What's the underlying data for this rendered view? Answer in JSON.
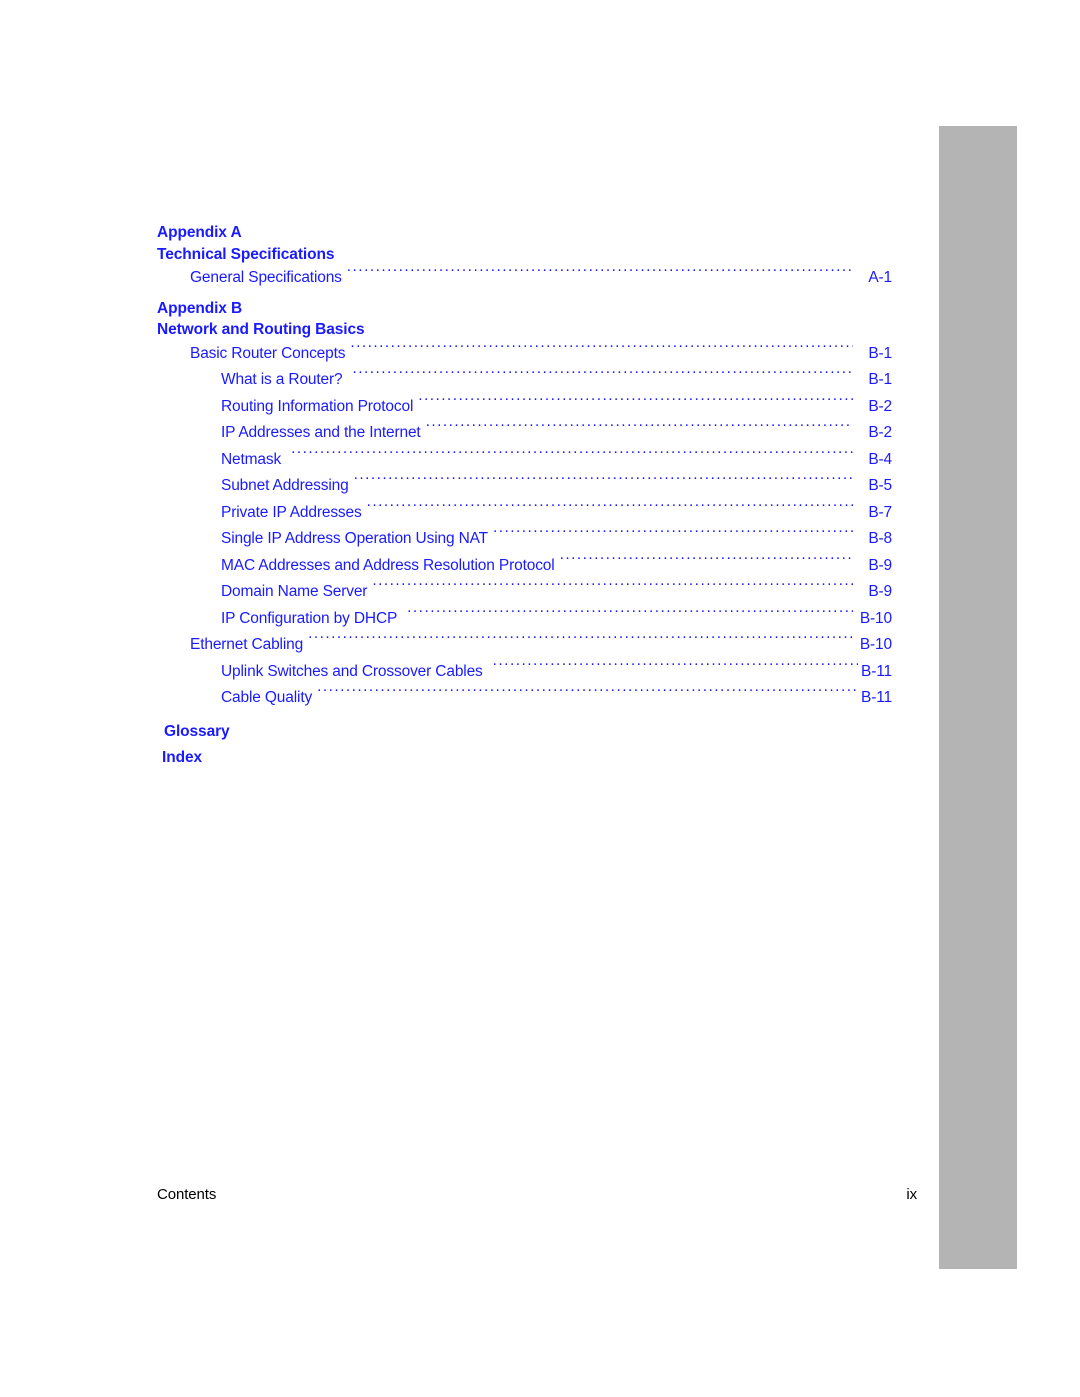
{
  "document": {
    "footer_left": "Contents",
    "footer_right": "ix",
    "text_color": "#1a1aff",
    "footer_color": "#000000",
    "edge_band_color": "#b4b4b4"
  },
  "toc": {
    "sections": [
      {
        "heading_lines": [
          "Appendix A",
          "Technical Specifications"
        ],
        "entries": [
          {
            "level": 1,
            "title": "General Specifications",
            "page": "A-1",
            "spacing": "normal"
          }
        ]
      },
      {
        "heading_lines": [
          "Appendix B",
          "Network and Routing Basics"
        ],
        "entries": [
          {
            "level": 1,
            "title": "Basic Router Concepts",
            "page": "B-1",
            "spacing": "normal"
          },
          {
            "level": 2,
            "title": "What is a Router?",
            "page": "B-1",
            "spacing": "wide-pre"
          },
          {
            "level": 2,
            "title": "Routing Information Protocol",
            "page": "B-2",
            "spacing": "normal"
          },
          {
            "level": 2,
            "title": "IP Addresses and the Internet",
            "page": "B-2",
            "spacing": "normal"
          },
          {
            "level": 2,
            "title": "Netmask",
            "page": "B-4",
            "spacing": "wide-pre"
          },
          {
            "level": 2,
            "title": "Subnet Addressing",
            "page": "B-5",
            "spacing": "normal"
          },
          {
            "level": 2,
            "title": "Private IP Addresses",
            "page": "B-7",
            "spacing": "normal"
          },
          {
            "level": 2,
            "title": "Single IP Address Operation Using NAT",
            "page": "B-8",
            "spacing": "normal"
          },
          {
            "level": 2,
            "title": "MAC Addresses and Address Resolution Protocol",
            "page": "B-9",
            "spacing": "normal"
          },
          {
            "level": 2,
            "title": "Domain Name Server",
            "page": "B-9",
            "spacing": "normal"
          },
          {
            "level": 2,
            "title": "IP Configuration by DHCP",
            "page": "B-10",
            "spacing": "wide-pre"
          },
          {
            "level": 1,
            "title": "Ethernet Cabling",
            "page": "B-10",
            "spacing": "normal"
          },
          {
            "level": 2,
            "title": "Uplink Switches and Crossover Cables",
            "page": "B-11",
            "spacing": "tight-wide"
          },
          {
            "level": 2,
            "title": "Cable Quality",
            "page": "B-11",
            "spacing": "tight"
          }
        ]
      }
    ],
    "standalone_headings": [
      "Glossary",
      "Index"
    ]
  }
}
